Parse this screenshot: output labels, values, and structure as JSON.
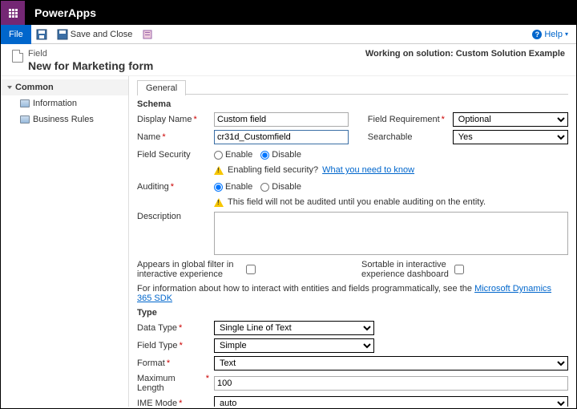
{
  "topbar": {
    "app_title": "PowerApps"
  },
  "toolbar": {
    "file": "File",
    "save_close": "Save and Close",
    "help": "Help"
  },
  "header": {
    "field_label": "Field",
    "title": "New for Marketing form",
    "working": "Working on solution: Custom Solution Example"
  },
  "sidebar": {
    "group": "Common",
    "items": [
      "Information",
      "Business Rules"
    ]
  },
  "tabs": {
    "general": "General"
  },
  "schema": {
    "section": "Schema",
    "display_name_label": "Display Name",
    "display_name_value": "Custom field",
    "field_req_label": "Field Requirement",
    "field_req_value": "Optional",
    "name_label": "Name",
    "name_value": "cr31d_Customfield",
    "searchable_label": "Searchable",
    "searchable_value": "Yes",
    "field_security_label": "Field Security",
    "enable": "Enable",
    "disable": "Disable",
    "security_warn": "Enabling field security?",
    "security_link": "What you need to know",
    "auditing_label": "Auditing",
    "auditing_warn": "This field will not be audited until you enable auditing on the entity.",
    "desc_label": "Description",
    "global_filter_label": "Appears in global filter in interactive experience",
    "sortable_label": "Sortable in interactive experience dashboard",
    "info_para_pre": "For information about how to interact with entities and fields programmatically, see the ",
    "info_para_link": "Microsoft Dynamics 365 SDK"
  },
  "type": {
    "section": "Type",
    "data_type_label": "Data Type",
    "data_type_value": "Single Line of Text",
    "field_type_label": "Field Type",
    "field_type_value": "Simple",
    "format_label": "Format",
    "format_value": "Text",
    "max_len_label": "Maximum Length",
    "max_len_value": "100",
    "ime_label": "IME Mode",
    "ime_value": "auto"
  }
}
